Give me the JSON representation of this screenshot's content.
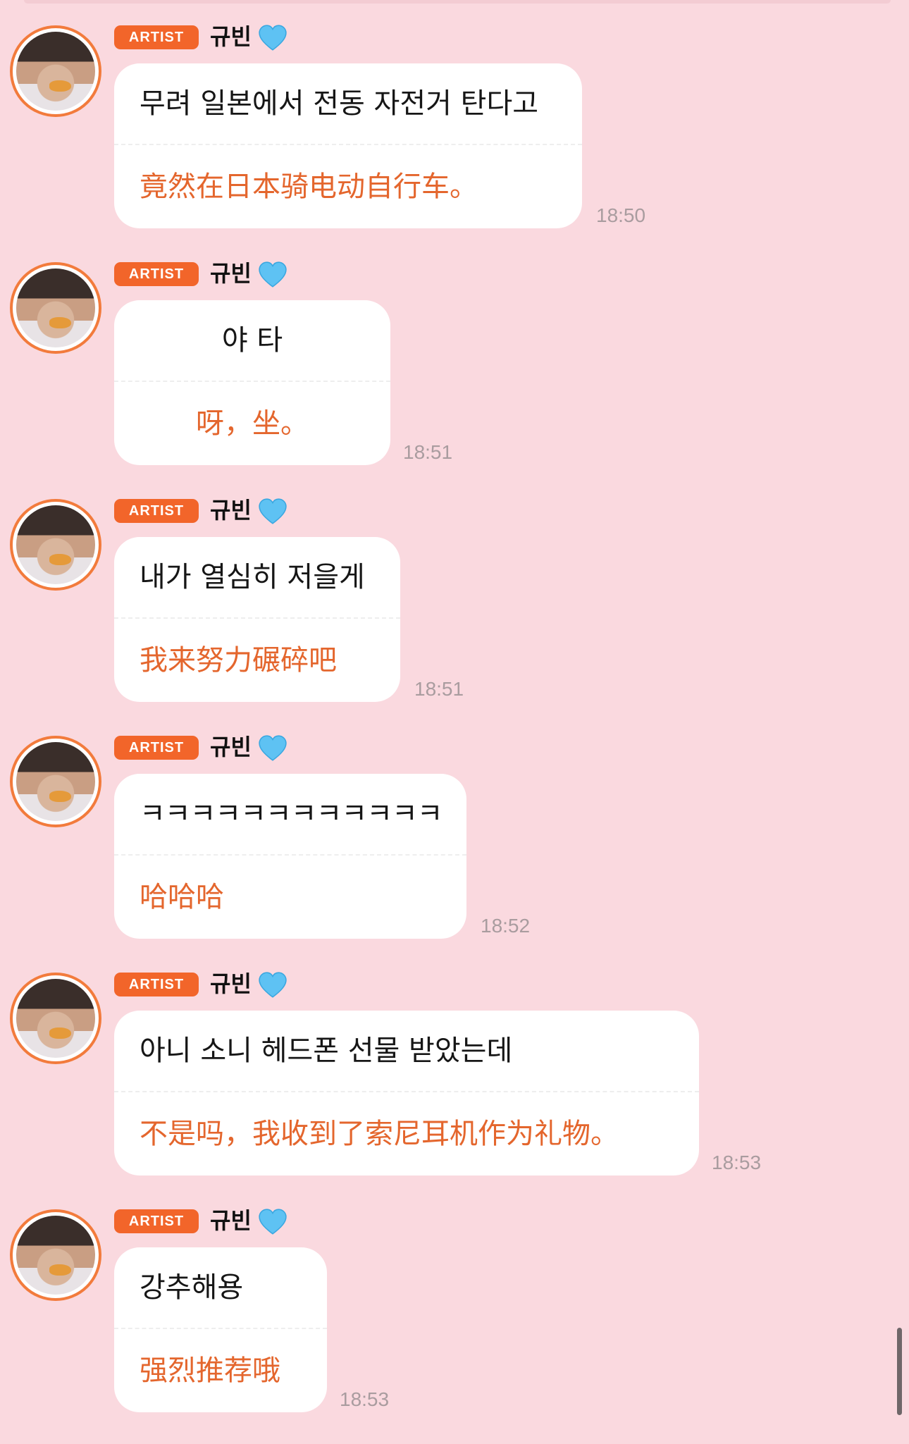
{
  "messages": [
    {
      "badge": "ARTIST",
      "name": "규빈",
      "text_ko": "무려 일본에서 전동 자전거 탄다고",
      "text_zh": "竟然在日本骑电动自行车。",
      "time": "18:50"
    },
    {
      "badge": "ARTIST",
      "name": "규빈",
      "text_ko": "야 타",
      "text_zh": "呀，坐。",
      "time": "18:51"
    },
    {
      "badge": "ARTIST",
      "name": "규빈",
      "text_ko": "내가 열심히 저을게",
      "text_zh": "我来努力碾碎吧",
      "time": "18:51"
    },
    {
      "badge": "ARTIST",
      "name": "규빈",
      "text_ko": "ㅋㅋㅋㅋㅋㅋㅋㅋㅋㅋㅋㅋ",
      "text_zh": "哈哈哈",
      "time": "18:52"
    },
    {
      "badge": "ARTIST",
      "name": "규빈",
      "text_ko": "아니 소니 헤드폰 선물 받았는데",
      "text_zh": "不是吗，我收到了索尼耳机作为礼物。",
      "time": "18:53"
    },
    {
      "badge": "ARTIST",
      "name": "규빈",
      "text_ko": "강추해용",
      "text_zh": "强烈推荐哦",
      "time": "18:53"
    }
  ],
  "colors": {
    "background": "#fad9df",
    "badge": "#f2652a",
    "avatar_ring": "#f27b3c",
    "translation_text": "#e4662d",
    "heart": "#5ec2f3"
  },
  "icons": {
    "name_suffix": "blue-heart-icon"
  }
}
